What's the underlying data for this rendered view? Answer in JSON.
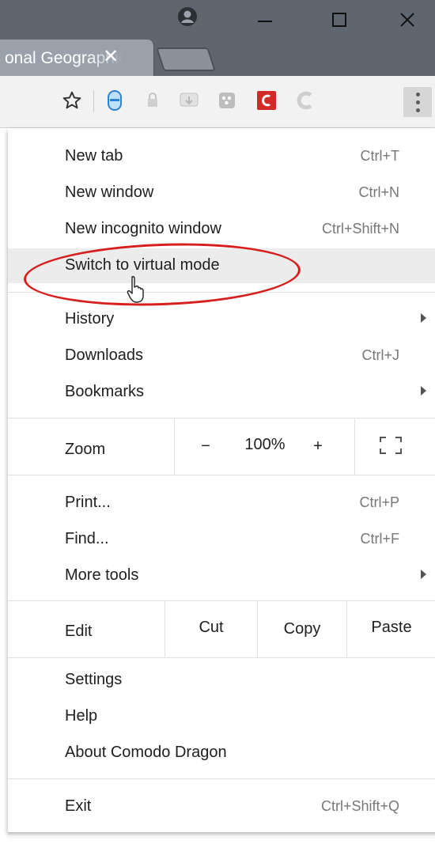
{
  "window": {
    "tab_title": "onal Geographic",
    "tab_close_glyph": "✕",
    "controls": [
      "minimize",
      "maximize",
      "close"
    ]
  },
  "toolbar": {
    "icons": [
      "star-icon",
      "shield-extension-icon",
      "lock-extension-icon",
      "download-extension-icon",
      "dots-extension-icon",
      "comodo-red-icon",
      "comodo-grey-icon",
      "menu-icon"
    ]
  },
  "menu": {
    "new_tab": {
      "label": "New tab",
      "shortcut": "Ctrl+T"
    },
    "new_window": {
      "label": "New window",
      "shortcut": "Ctrl+N"
    },
    "new_incognito": {
      "label": "New incognito window",
      "shortcut": "Ctrl+Shift+N"
    },
    "virtual_mode": {
      "label": "Switch to virtual mode"
    },
    "history": {
      "label": "History"
    },
    "downloads": {
      "label": "Downloads",
      "shortcut": "Ctrl+J"
    },
    "bookmarks": {
      "label": "Bookmarks"
    },
    "zoom": {
      "label": "Zoom",
      "minus": "−",
      "value": "100%",
      "plus": "+"
    },
    "print": {
      "label": "Print...",
      "shortcut": "Ctrl+P"
    },
    "find": {
      "label": "Find...",
      "shortcut": "Ctrl+F"
    },
    "more_tools": {
      "label": "More tools"
    },
    "edit": {
      "label": "Edit",
      "cut": "Cut",
      "copy": "Copy",
      "paste": "Paste"
    },
    "settings": {
      "label": "Settings"
    },
    "help": {
      "label": "Help"
    },
    "about": {
      "label": "About Comodo Dragon"
    },
    "exit": {
      "label": "Exit",
      "shortcut": "Ctrl+Shift+Q"
    }
  },
  "colors": {
    "titlebar": "#5f6670",
    "annotation": "#d6201f",
    "comodo_red": "#d42a27"
  }
}
